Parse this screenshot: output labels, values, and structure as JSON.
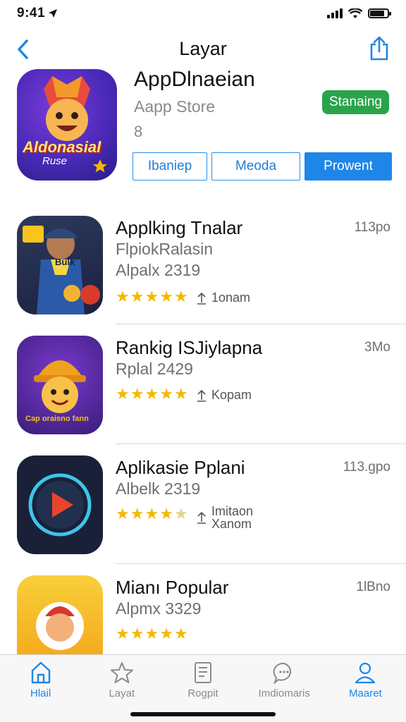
{
  "status": {
    "time": "9:41"
  },
  "nav": {
    "title": "Layar"
  },
  "hero": {
    "title": "AppDlnaeian",
    "subtitle": "Aapp Store",
    "number": "8",
    "badge": "Stanaing",
    "icon_text": "Aldonasial",
    "icon_subtext": "Ruse",
    "segments": [
      "Ibaniep",
      "Meoda",
      "Prowent"
    ]
  },
  "apps": [
    {
      "name": "Applking Tnalar",
      "size": "113po",
      "line2": "FlpiokRalasin",
      "line3": "Alpalx 2319",
      "rating": 5,
      "meta": "1onam",
      "meta_icon": "download-icon",
      "icon_text": "Bulk"
    },
    {
      "name": "Rankig ISJiylapna",
      "size": "3Mo",
      "line2": "Rplal 2429",
      "line3": "",
      "rating": 5,
      "meta": "Kopam",
      "meta_icon": "download-icon",
      "icon_text": "Cap oraisno fann"
    },
    {
      "name": "Aplikasie  Pplani",
      "size": "113.gpo",
      "line2": "Albelk 2319",
      "line3": "",
      "rating": 4.5,
      "meta": "Imitaon Xanom",
      "meta_icon": "download-icon",
      "icon_text": ""
    },
    {
      "name": "Mianı Popular",
      "size": "1lBno",
      "line2": "Alpmx 3329",
      "line3": "",
      "rating": 5,
      "meta": "",
      "meta_icon": "",
      "icon_text": ""
    }
  ],
  "tabs": [
    {
      "label": "Hlail",
      "icon": "home-icon",
      "active": true
    },
    {
      "label": "Layat",
      "icon": "star-icon",
      "active": false
    },
    {
      "label": "Rogpit",
      "icon": "document-icon",
      "active": false
    },
    {
      "label": "Imdiomaris",
      "icon": "chat-icon",
      "active": false
    },
    {
      "label": "Maaret",
      "icon": "person-icon",
      "active": true
    }
  ],
  "colors": {
    "accent": "#1e86e8",
    "badge": "#2aa44a",
    "star": "#f5b800"
  }
}
